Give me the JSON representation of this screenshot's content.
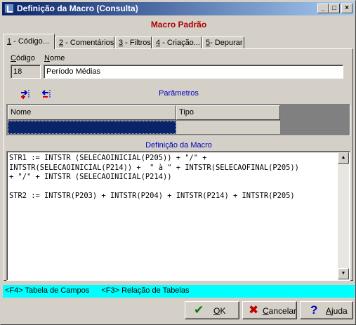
{
  "window": {
    "title": "Definição da Macro (Consulta)",
    "minimize_glyph": "_",
    "maximize_glyph": "□",
    "close_glyph": "×"
  },
  "heading": "Macro Padrão",
  "tabs": [
    {
      "key": "1",
      "label": " - Código..."
    },
    {
      "key": "2",
      "label": " - Comentários"
    },
    {
      "key": "3",
      "label": " - Filtros"
    },
    {
      "key": "4",
      "label": " - Criação..."
    },
    {
      "key": "5",
      "label": "- Depurar"
    }
  ],
  "form": {
    "codigo_label_key": "C",
    "codigo_label_rest": "ódigo",
    "codigo_value": "18",
    "nome_label_key": "N",
    "nome_label_rest": "ome",
    "nome_value": "Período Médias"
  },
  "parametros": {
    "title": "Parâmetros",
    "columns": [
      "Nome",
      "Tipo"
    ],
    "rows": [
      [
        "",
        ""
      ]
    ]
  },
  "definicao": {
    "title": "Definição da Macro",
    "code": "STR1 := INTSTR (SELECAOINICIAL(P205)) + \"/\" +\nINTSTR(SELECAOINICIAL(P214)) +  \" à \" + INTSTR(SELECAOFINAL(P205))\n+ \"/\" + INTSTR (SELECAOINICIAL(P214))\n\nSTR2 := INTSTR(P203) + INTSTR(P204) + INTSTR(P214) + INTSTR(P205)"
  },
  "status": {
    "f4": "<F4> Tabela de Campos",
    "f3": "<F3> Relação de Tabelas"
  },
  "buttons": {
    "ok_key": "O",
    "ok_rest": "K",
    "cancel_key": "C",
    "cancel_rest": "ancelar",
    "help_key": "A",
    "help_rest": "juda"
  },
  "colors": {
    "heading": "#b00000",
    "section_title": "#0000c0",
    "status_bg": "#00ffff",
    "selected_row": "#0a246a"
  }
}
